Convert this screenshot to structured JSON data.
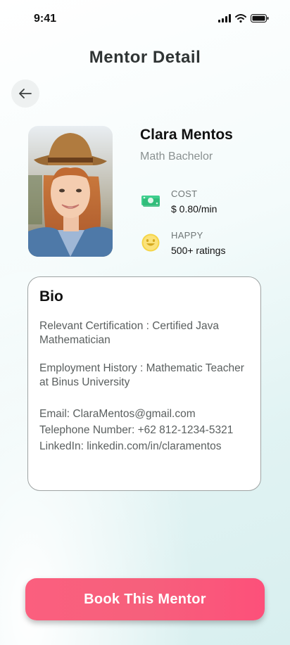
{
  "status_bar": {
    "time": "9:41"
  },
  "header": {
    "title": "Mentor Detail"
  },
  "mentor": {
    "name": "Clara Mentos",
    "degree": "Math Bachelor",
    "cost": {
      "label": "COST",
      "value": "$ 0.80/min",
      "icon": "money-icon"
    },
    "happy": {
      "label": "HAPPY",
      "value": "500+ ratings",
      "icon": "smiley-icon"
    }
  },
  "bio": {
    "title": "Bio",
    "lines": [
      "Relevant Certification : Certified Java Mathematician",
      "Employment History : Mathematic Teacher at Binus University",
      "Email: ClaraMentos@gmail.com",
      "Telephone Number: +62 812-1234-5321",
      "LinkedIn: linkedin.com/in/claramentos"
    ]
  },
  "actions": {
    "book_label": "Book This Mentor"
  },
  "colors": {
    "accent": "#f9607c",
    "money": "#3ecf8e",
    "smiley": "#f5d547"
  }
}
